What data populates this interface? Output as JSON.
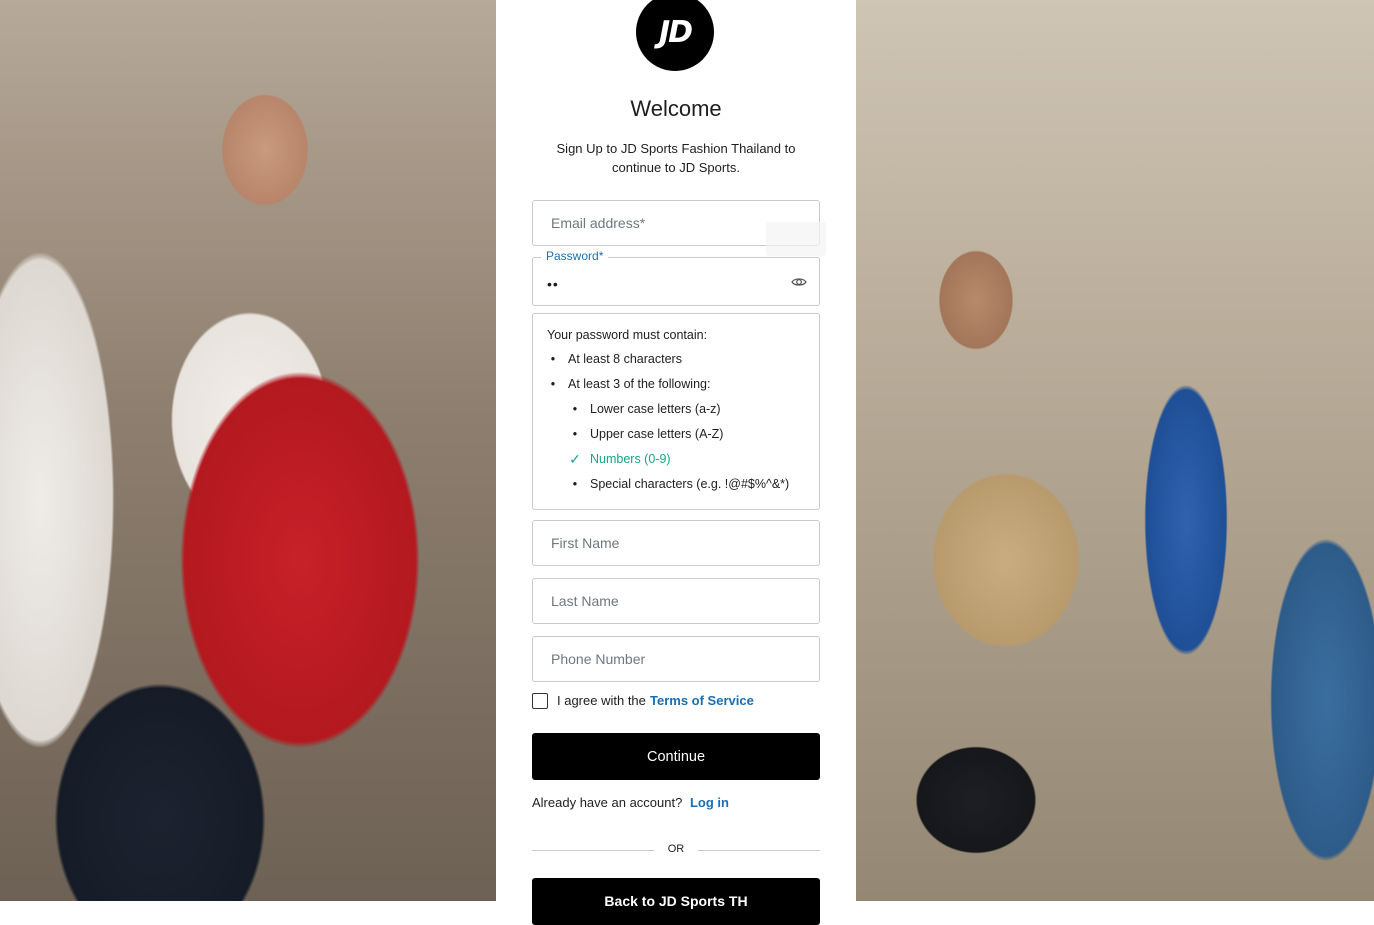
{
  "logo": {
    "text": "JD"
  },
  "header": {
    "title": "Welcome",
    "subtitle": "Sign Up to JD Sports Fashion Thailand to continue to JD Sports."
  },
  "form": {
    "email": {
      "placeholder": "Email address*",
      "value": ""
    },
    "password": {
      "label": "Password*",
      "value_masked": "••",
      "toggle_icon": "eye-icon"
    },
    "password_rules": {
      "heading": "Your password must contain:",
      "rules": [
        {
          "text": "At least 8 characters",
          "level": 1,
          "met": false
        },
        {
          "text": "At least 3 of the following:",
          "level": 1,
          "met": false
        },
        {
          "text": "Lower case letters (a-z)",
          "level": 2,
          "met": false
        },
        {
          "text": "Upper case letters (A-Z)",
          "level": 2,
          "met": false
        },
        {
          "text": "Numbers (0-9)",
          "level": 2,
          "met": true
        },
        {
          "text": "Special characters (e.g. !@#$%^&*)",
          "level": 2,
          "met": false
        }
      ],
      "bullet": "•",
      "check": "✓"
    },
    "first_name": {
      "placeholder": "First Name"
    },
    "last_name": {
      "placeholder": "Last Name"
    },
    "phone": {
      "placeholder": "Phone Number"
    },
    "agree": {
      "text": "I agree with the",
      "link": "Terms of Service",
      "checked": false
    }
  },
  "actions": {
    "continue_label": "Continue",
    "account_text": "Already have an account?",
    "login_link": "Log in",
    "or_text": "OR",
    "back_label": "Back to JD Sports TH"
  },
  "colors": {
    "link": "#1a6fb3",
    "success": "#18a586",
    "button": "#000000"
  }
}
